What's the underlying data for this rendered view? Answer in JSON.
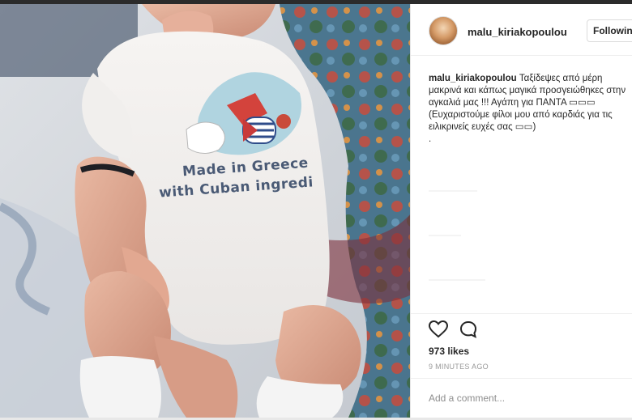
{
  "post": {
    "username": "malu_kiriakopoulou",
    "follow_label": "Following",
    "caption_user": "malu_kiriakopoulou",
    "caption_text": "Ταξίδεψες από μέρη μακρινά και κάπως μαγικά προσγειώθηκες στην αγκαλιά μας !!! Αγάπη για ΠΑΝΤΑ ▭▭▭ (Ευχαριστούμε φίλοι μου από καρδιάς για τις ειλικρινείς ευχές σας ▭▭)",
    "caption_trailing": ".",
    "likes": "973 likes",
    "time": "9 MINUTES AGO",
    "comment_placeholder": "Add a comment..."
  },
  "photo": {
    "onesie_line1": "Made in Greece",
    "onesie_line2": "with Cuban ingredi"
  },
  "icons": {
    "heart": "heart-icon",
    "comment": "comment-icon"
  }
}
